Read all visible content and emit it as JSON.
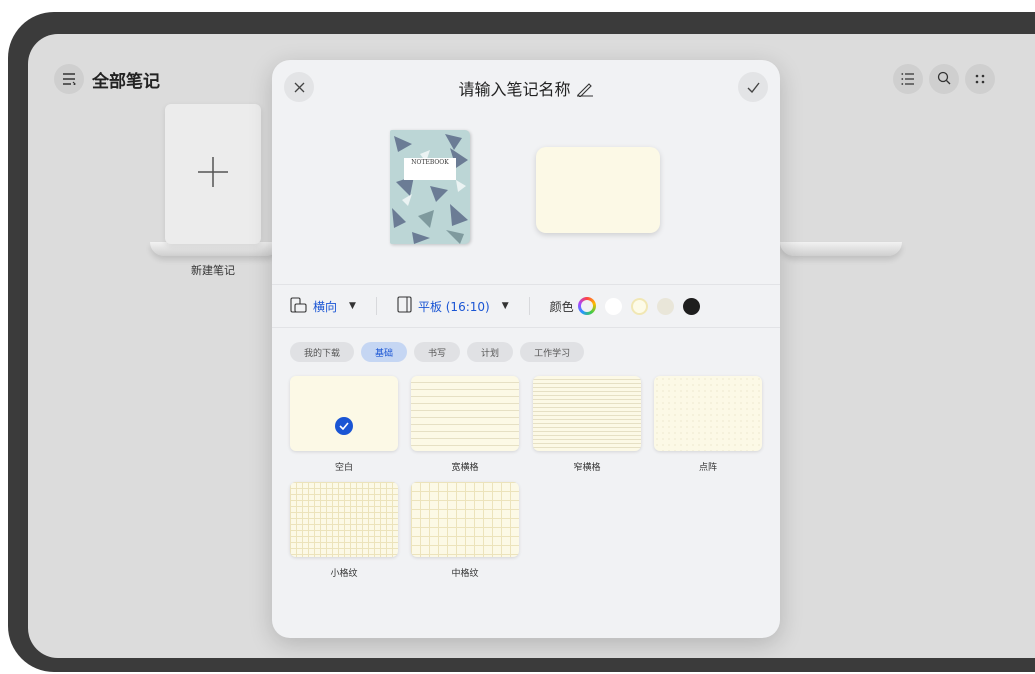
{
  "app": {
    "title": "全部笔记"
  },
  "toolbar": {
    "list_icon": "list-icon",
    "search_icon": "search-icon",
    "more_icon": "more-icon"
  },
  "shelf": {
    "new_note_label": "新建笔记"
  },
  "dialog": {
    "title": "请输入笔记名称",
    "cover_text": "NOTEBOOK",
    "orientation": "横向",
    "paper_size": "平板 (16:10)",
    "color_label": "颜色",
    "colors": [
      "#ffffff",
      "#fdfbe8",
      "#e9e6d9",
      "#1e1e1e"
    ],
    "accent": "#1a55d4",
    "selected_template": "空白"
  },
  "tabs": [
    "我的下载",
    "基础",
    "书写",
    "计划",
    "工作学习"
  ],
  "active_tab": "基础",
  "templates": [
    {
      "name": "空白"
    },
    {
      "name": "宽横格"
    },
    {
      "name": "窄横格"
    },
    {
      "name": "点阵"
    },
    {
      "name": "小格纹"
    },
    {
      "name": "中格纹"
    }
  ]
}
